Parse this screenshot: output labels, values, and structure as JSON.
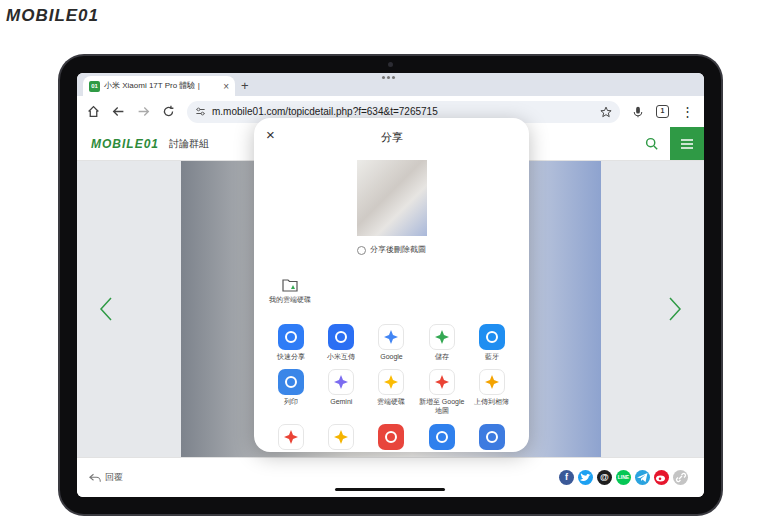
{
  "watermark": "MOBILE01",
  "browser": {
    "tab": {
      "favicon": "01",
      "title": "小米 Xiaomi 17T Pro 體驗 |",
      "close": "×",
      "selected": true
    },
    "new_tab": "+",
    "url": "m.mobile01.com/topicdetail.php?f=634&t=7265715",
    "tab_count": "1",
    "menu": "⋮"
  },
  "site": {
    "logo": "MOBILE01",
    "section": "討論群組"
  },
  "share": {
    "close": "×",
    "title": "分享",
    "delete_after_share": {
      "label": "分享後刪除截圖",
      "checked": false
    },
    "shortcut": {
      "label": "我的雲端硬碟"
    },
    "apps": [
      {
        "label": "快速分享",
        "kind": "tile",
        "color": "#2f7cf6"
      },
      {
        "label": "小米互傳",
        "kind": "tile",
        "color": "#2b6ff3"
      },
      {
        "label": "Google",
        "kind": "logo",
        "color": "#4285f4"
      },
      {
        "label": "儲存",
        "kind": "logo",
        "color": "#34a853"
      },
      {
        "label": "藍牙",
        "kind": "tile",
        "color": "#1f8ef1"
      },
      {
        "label": "列印",
        "kind": "tile",
        "color": "#3a86e8"
      },
      {
        "label": "Gemini",
        "kind": "logo",
        "color": "#7b6cf0"
      },
      {
        "label": "雲端硬碟",
        "kind": "logo",
        "color": "#fbbc04"
      },
      {
        "label": "新增至 Google 地圖",
        "kind": "logo",
        "color": "#ea4335"
      },
      {
        "label": "上傳到相簿",
        "kind": "logo",
        "color": "#f4a300"
      }
    ],
    "more_apps": [
      {
        "kind": "logo",
        "color": "#ea4335"
      },
      {
        "kind": "logo",
        "color": "#f5b400"
      },
      {
        "kind": "tile",
        "color": "#e8453c"
      },
      {
        "kind": "tile",
        "color": "#2f80ed"
      },
      {
        "kind": "tile",
        "color": "#3d7be0"
      }
    ]
  },
  "footer": {
    "reply": "回覆",
    "social": [
      {
        "kind": "text",
        "text": "f",
        "color": "#3b5998"
      },
      {
        "kind": "bird",
        "color": "#1da1f2"
      },
      {
        "kind": "text",
        "text": "@",
        "color": "#1e1e1e"
      },
      {
        "kind": "text",
        "text": "LINE",
        "color": "#06c755"
      },
      {
        "kind": "plane",
        "color": "#2aa3df"
      },
      {
        "kind": "weibo",
        "color": "#e6162d"
      },
      {
        "kind": "link",
        "color": "#c4c4c4"
      }
    ]
  }
}
